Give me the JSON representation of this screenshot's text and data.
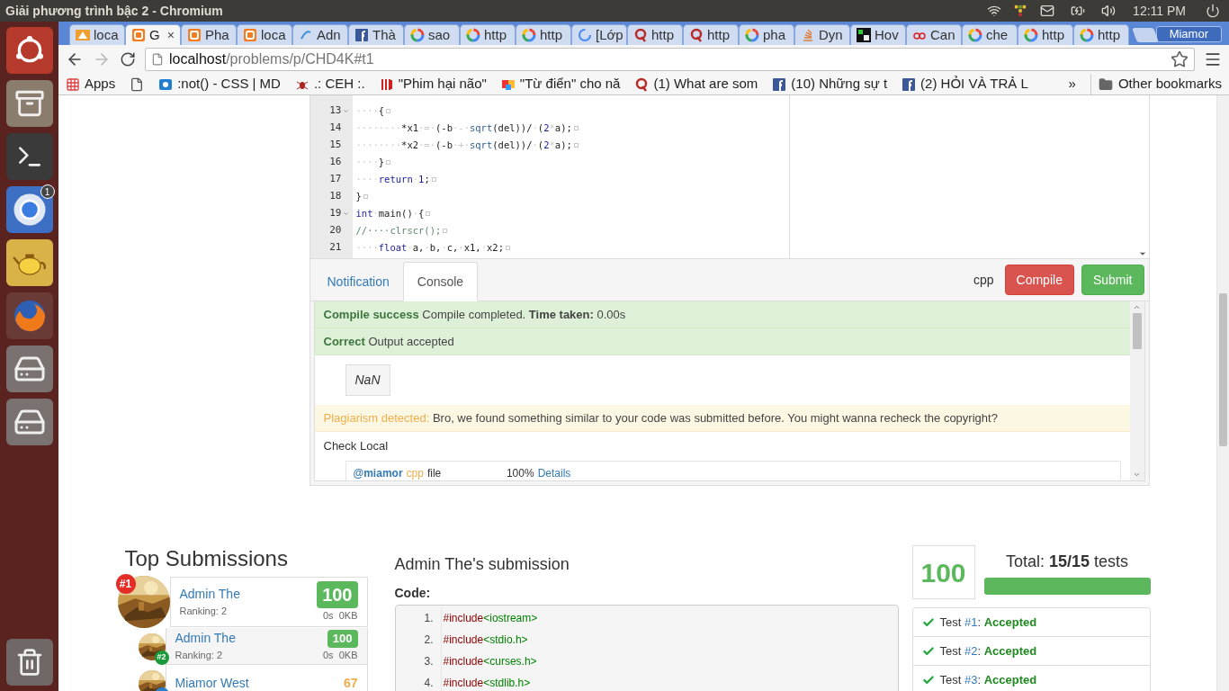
{
  "os_panel": {
    "title": "Giải phương trình bậc 2 - Chromium",
    "time": "12:11 PM"
  },
  "launcher": [
    {
      "kind": "dash"
    },
    {
      "kind": "files"
    },
    {
      "kind": "terminal"
    },
    {
      "kind": "browser",
      "badge": "1"
    },
    {
      "kind": "teapot"
    },
    {
      "kind": "firefox"
    },
    {
      "kind": "drive"
    },
    {
      "kind": "drive"
    },
    {
      "kind": "trash"
    }
  ],
  "browser": {
    "tabs": [
      {
        "title": "loca",
        "selected": false
      },
      {
        "title": "G",
        "selected": true
      },
      {
        "title": "Pha",
        "selected": false
      },
      {
        "title": "loca",
        "selected": false
      },
      {
        "title": "Adn",
        "selected": false
      },
      {
        "title": "Thà",
        "selected": false
      },
      {
        "title": "sao",
        "selected": false
      },
      {
        "title": "http",
        "selected": false
      },
      {
        "title": "http",
        "selected": false
      },
      {
        "title": "[Lớp",
        "selected": false
      },
      {
        "title": "http",
        "selected": false
      },
      {
        "title": "http",
        "selected": false
      },
      {
        "title": "pha",
        "selected": false
      },
      {
        "title": "Dyn",
        "selected": false
      },
      {
        "title": "Hov",
        "selected": false
      },
      {
        "title": "Can",
        "selected": false
      },
      {
        "title": "che",
        "selected": false
      },
      {
        "title": "http",
        "selected": false
      },
      {
        "title": "http",
        "selected": false
      }
    ],
    "close": "×",
    "profile": "Miamor",
    "address": {
      "host": "localhost",
      "path": "/problems/p/CHD4K#t1"
    },
    "bookmarks": [
      "Apps",
      ":not() - CSS | MD",
      ".: CEH :.",
      "\"Phim hại não\"",
      "\"Từ điển\" cho nă",
      "(1) What are som",
      "(10) Những sự t",
      "(2) HỎI VÀ TRẢ L"
    ],
    "overflow": "»",
    "other": "Other bookmarks"
  },
  "editor": {
    "lines": [
      {
        "n": "13",
        "fold": true,
        "tokens": [
          {
            "text": "····",
            "kind": "space"
          },
          {
            "text": "{",
            "kind": "plain"
          }
        ]
      },
      {
        "n": "14",
        "fold": false,
        "tokens": [
          {
            "text": "········",
            "kind": "space"
          },
          {
            "text": "*x1",
            "kind": "plain"
          },
          {
            "text": "·=·",
            "kind": "space"
          },
          {
            "text": "(-b",
            "kind": "plain"
          },
          {
            "text": "·-·",
            "kind": "space"
          },
          {
            "text": "sqrt",
            "kind": "function"
          },
          {
            "text": "(del))/",
            "kind": "plain"
          },
          {
            "text": "·",
            "kind": "space"
          },
          {
            "text": "(",
            "kind": "plain"
          },
          {
            "text": "2",
            "kind": "number"
          },
          {
            "text": "*",
            "kind": "space"
          },
          {
            "text": "a);",
            "kind": "plain"
          }
        ]
      },
      {
        "n": "15",
        "fold": false,
        "tokens": [
          {
            "text": "········",
            "kind": "space"
          },
          {
            "text": "*x2",
            "kind": "plain"
          },
          {
            "text": "·=·",
            "kind": "space"
          },
          {
            "text": "(-b",
            "kind": "plain"
          },
          {
            "text": "·+·",
            "kind": "space"
          },
          {
            "text": "sqrt",
            "kind": "function"
          },
          {
            "text": "(del))/",
            "kind": "plain"
          },
          {
            "text": "·",
            "kind": "space"
          },
          {
            "text": "(",
            "kind": "plain"
          },
          {
            "text": "2",
            "kind": "number"
          },
          {
            "text": "*",
            "kind": "space"
          },
          {
            "text": "a);",
            "kind": "plain"
          }
        ]
      },
      {
        "n": "16",
        "fold": false,
        "tokens": [
          {
            "text": "····",
            "kind": "space"
          },
          {
            "text": "}",
            "kind": "plain"
          }
        ]
      },
      {
        "n": "17",
        "fold": false,
        "tokens": [
          {
            "text": "····",
            "kind": "space"
          },
          {
            "text": "return",
            "kind": "keyword"
          },
          {
            "text": "·",
            "kind": "space"
          },
          {
            "text": "1",
            "kind": "number"
          },
          {
            "text": ";",
            "kind": "plain"
          }
        ]
      },
      {
        "n": "18",
        "fold": false,
        "tokens": [
          {
            "text": "}",
            "kind": "plain"
          }
        ]
      },
      {
        "n": "19",
        "fold": true,
        "tokens": [
          {
            "text": "int",
            "kind": "keyword"
          },
          {
            "text": "·",
            "kind": "space"
          },
          {
            "text": "main()",
            "kind": "plain"
          },
          {
            "text": "·",
            "kind": "space"
          },
          {
            "text": "{",
            "kind": "plain"
          }
        ]
      },
      {
        "n": "20",
        "fold": false,
        "tokens": [
          {
            "text": "//····clrscr();",
            "kind": "comment"
          }
        ]
      },
      {
        "n": "21",
        "fold": false,
        "tokens": [
          {
            "text": "····",
            "kind": "space"
          },
          {
            "text": "float",
            "kind": "keyword"
          },
          {
            "text": "·",
            "kind": "space"
          },
          {
            "text": "a,",
            "kind": "plain"
          },
          {
            "text": "·",
            "kind": "space"
          },
          {
            "text": "b,",
            "kind": "plain"
          },
          {
            "text": "·",
            "kind": "space"
          },
          {
            "text": "c,",
            "kind": "plain"
          },
          {
            "text": "·",
            "kind": "space"
          },
          {
            "text": "x1,",
            "kind": "plain"
          },
          {
            "text": "·",
            "kind": "space"
          },
          {
            "text": "x2;",
            "kind": "plain"
          }
        ]
      }
    ]
  },
  "console_bar": {
    "tabs": [
      {
        "label": "Notification",
        "selected": false
      },
      {
        "label": "Console",
        "selected": true
      }
    ],
    "language": "cpp",
    "buttons": [
      {
        "label": "Compile",
        "kind": "danger"
      },
      {
        "label": "Submit",
        "kind": "success"
      }
    ]
  },
  "console": {
    "messages": [
      {
        "kind": "success",
        "title": "Compile success",
        "body": "Compile completed. **Time taken:** 0.00s"
      },
      {
        "kind": "success",
        "title": "Correct",
        "body": "Output accepted"
      },
      {
        "kind": "output",
        "body": "NaN"
      },
      {
        "kind": "warning",
        "title": "Plagiarism detected:",
        "body": "Bro, we found something similar to your code was submitted before. You might wanna recheck the copyright?"
      }
    ],
    "check": {
      "title": "Check Local",
      "rows": [
        {
          "user": "@miamor",
          "language": "cpp",
          "file": "file",
          "percent": "100%",
          "link": "Details"
        }
      ]
    }
  },
  "top_submissions": {
    "title": "Top Submissions",
    "items": [
      {
        "kind": "first",
        "rank": {
          "text": "#1",
          "color": "#e52d27"
        },
        "name": "Admin The",
        "ranking": "Ranking: 2",
        "score": {
          "text": "100",
          "color": "#5cb85c"
        },
        "stats": "0s  0KB"
      },
      {
        "kind": "other",
        "rank": {
          "text": "#2",
          "color": "#1a9a3a"
        },
        "name": "Admin The",
        "ranking": "Ranking: 2",
        "score": {
          "text": "100",
          "color": "#5cb85c"
        },
        "stats": "0s  0KB"
      },
      {
        "kind": "other",
        "rank": {
          "color": "#2a7fc9"
        },
        "name": "Miamor West",
        "score": {
          "text": "67",
          "color": "#f0ad4e"
        }
      }
    ]
  },
  "submission": {
    "title": "Admin The's submission",
    "code_label": "Code:",
    "lines": [
      {
        "n": "1.",
        "directive": "#include",
        "header": "<iostream>"
      },
      {
        "n": "2.",
        "directive": "#include",
        "header": "<stdio.h>"
      },
      {
        "n": "3.",
        "directive": "#include",
        "header": "<curses.h>"
      },
      {
        "n": "4.",
        "directive": "#include",
        "header": "<stdlib.h>"
      }
    ]
  },
  "result": {
    "score": "100",
    "total": "Total: **15/15** tests",
    "level": 1,
    "tests": [
      {
        "label": "Test",
        "number": "#1",
        "separator": ":",
        "status": "Accepted"
      },
      {
        "label": "Test",
        "number": "#2",
        "separator": ":",
        "status": "Accepted"
      },
      {
        "label": "Test",
        "number": "#3",
        "separator": ":",
        "status": "Accepted"
      }
    ]
  }
}
